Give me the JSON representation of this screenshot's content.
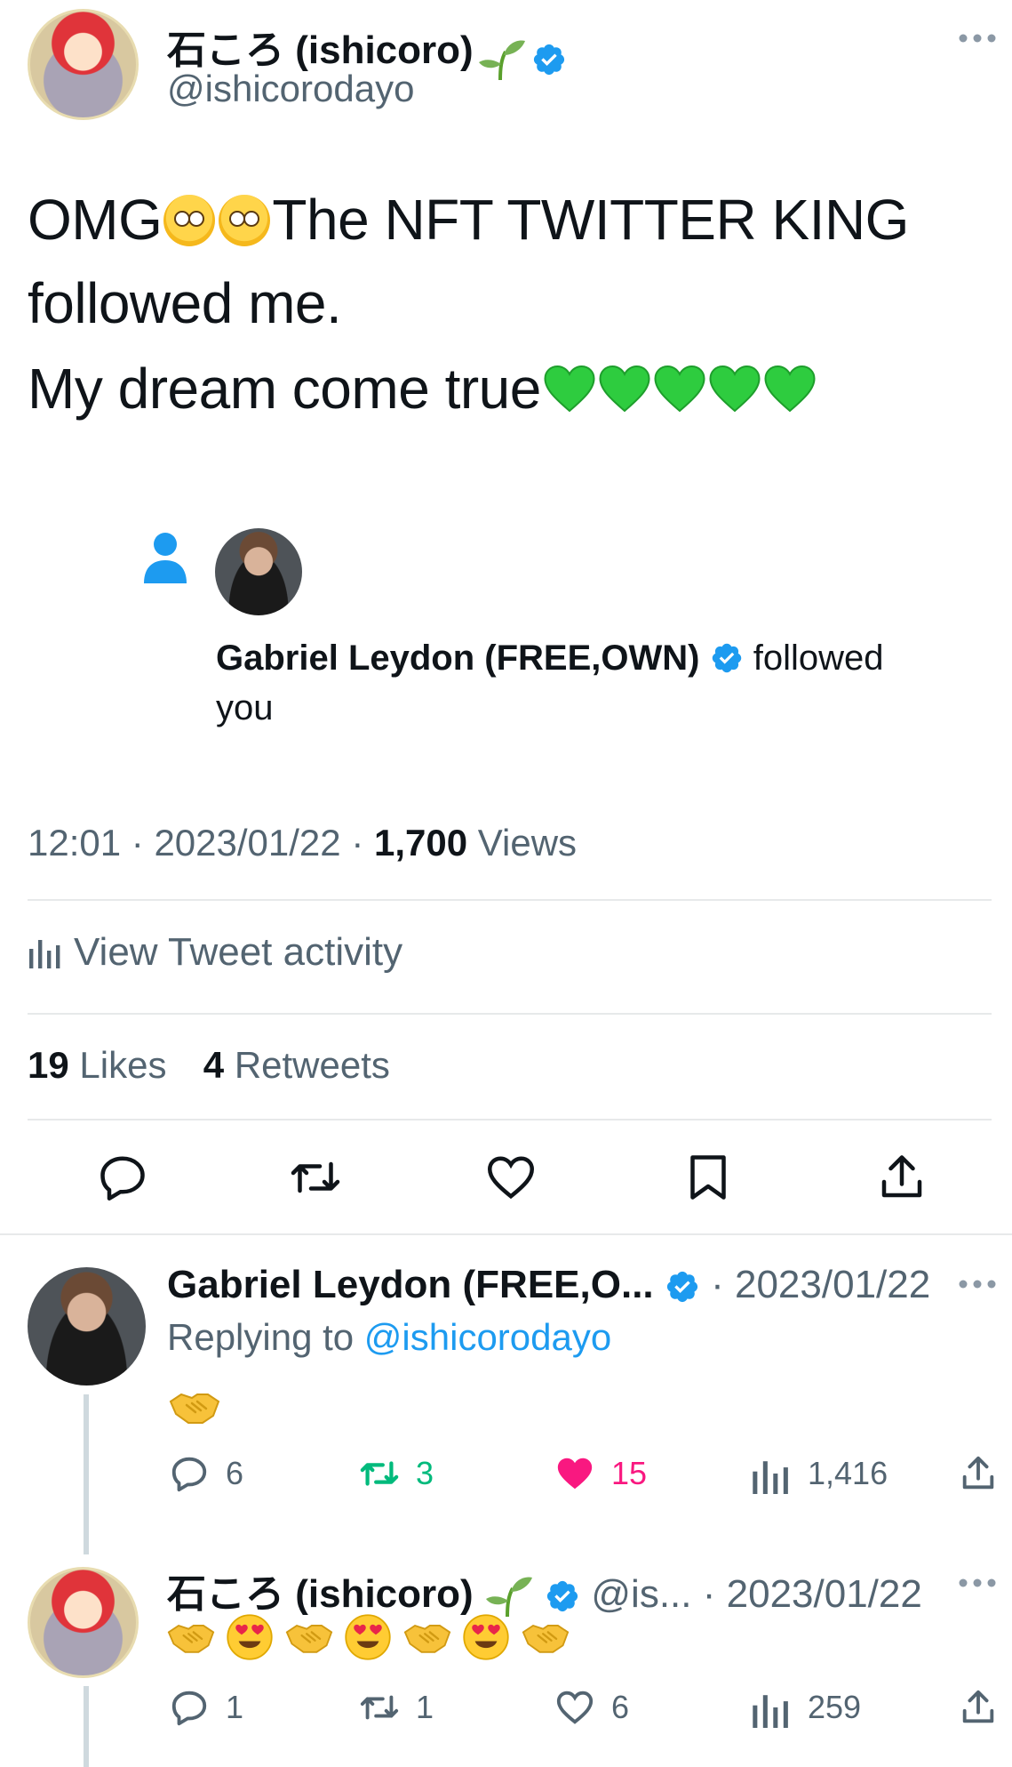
{
  "main_tweet": {
    "author_name": "石ころ (ishicoro)",
    "author_handle": "@ishicorodayo",
    "body_line1_a": "OMG",
    "body_line1_b": "The NFT TWITTER KING",
    "body_line2": "followed me.",
    "body_line3": "My dream come true",
    "quoted_notification": {
      "name": "Gabriel Leydon (FREE,OWN)",
      "action": "followed",
      "object": "you"
    },
    "time": "12:01",
    "date": "2023/01/22",
    "views_count": "1,700",
    "views_label": "Views",
    "activity_label": "View Tweet activity",
    "likes_count": "19",
    "likes_label": "Likes",
    "retweets_count": "4",
    "retweets_label": "Retweets"
  },
  "reply1": {
    "author_name": "Gabriel Leydon (FREE,O...",
    "date": "· 2023/01/22",
    "replying_prefix": "Replying to",
    "replying_handle": "@ishicorodayo",
    "reply_count": "6",
    "retweet_count": "3",
    "like_count": "15",
    "view_count": "1,416"
  },
  "reply2": {
    "author_name": "石ころ (ishicoro)",
    "handle": "@is...",
    "date": "· 2023/01/22",
    "reply_count": "1",
    "retweet_count": "1",
    "like_count": "6",
    "view_count": "259"
  },
  "colors": {
    "accent": "#1d9bf0",
    "retweet_active": "#00ba7c",
    "like_active": "#f91880",
    "muted": "#536471"
  }
}
